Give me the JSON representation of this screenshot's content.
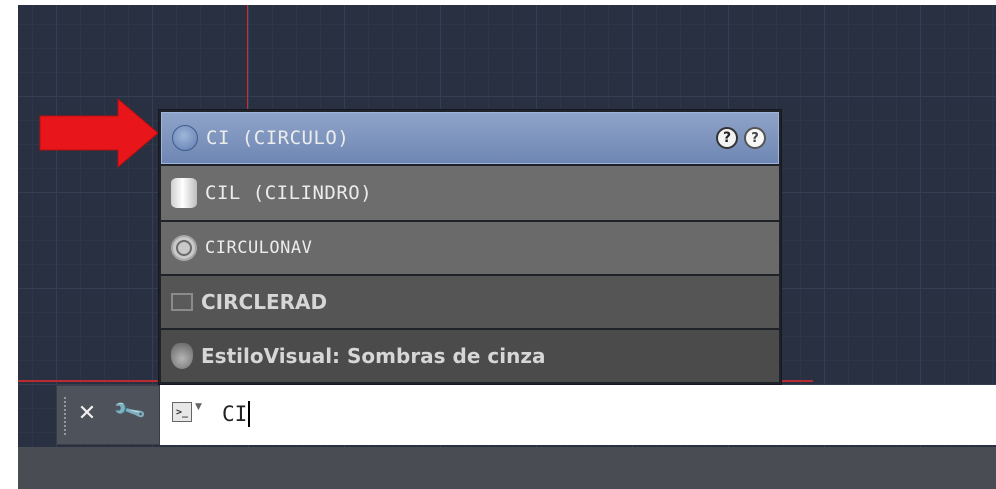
{
  "autocomplete": {
    "items": [
      {
        "label": "CI (CIRCULO)",
        "icon": "circle-icon",
        "style": "mono",
        "selected": true
      },
      {
        "label": "CIL (CILINDRO)",
        "icon": "cylinder-icon",
        "style": "mono"
      },
      {
        "label": "CIRCULONAV",
        "icon": "navigation-wheel-icon",
        "style": "mono"
      },
      {
        "label": "CIRCLERAD",
        "icon": "system-variable-icon",
        "style": "bold"
      },
      {
        "label": "EstiloVisual: Sombras de cinza",
        "icon": "visual-style-icon",
        "style": "bold"
      }
    ],
    "help_icons": [
      "help-icon",
      "online-help-icon"
    ],
    "selected_color": "#7890bb"
  },
  "command_line": {
    "close_icon": "close-icon",
    "customize_icon": "wrench-icon",
    "prompt_icon": "command-prompt-icon",
    "input_value": "CI"
  },
  "colors": {
    "arrow": "#e8161a",
    "crosshair": "#d22c30",
    "drawing_area": "#283041"
  }
}
